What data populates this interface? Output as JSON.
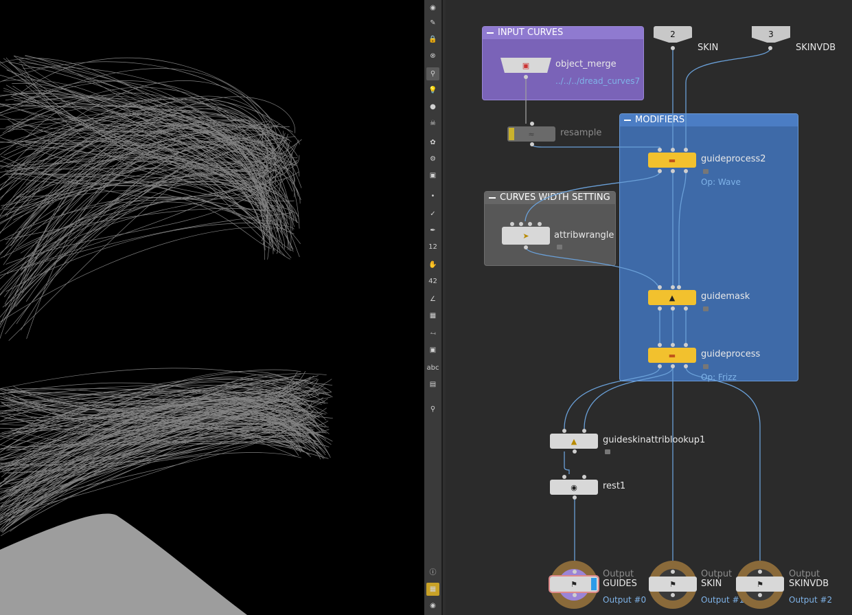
{
  "network": {
    "boxes": {
      "input_curves": "INPUT CURVES",
      "modifiers": "MODIFIERS",
      "curves_width": "CURVES WIDTH SETTING"
    },
    "subnet_inputs": [
      {
        "index": "2",
        "label": "SKIN"
      },
      {
        "index": "3",
        "label": "SKINVDB"
      }
    ],
    "nodes": {
      "object_merge": {
        "name": "object_merge",
        "sub": "../../../dread_curves7"
      },
      "resample": {
        "name": "resample"
      },
      "attribwrangle": {
        "name": "attribwrangle"
      },
      "guideprocess2": {
        "name": "guideprocess2",
        "sub": "Op: Wave"
      },
      "guidemask": {
        "name": "guidemask"
      },
      "guideprocess": {
        "name": "guideprocess",
        "sub": "Op: Frizz"
      },
      "guideskinattriblookup1": {
        "name": "guideskinattriblookup1"
      },
      "rest1": {
        "name": "rest1"
      }
    },
    "outputs": [
      {
        "type": "Output",
        "name": "GUIDES",
        "index": "Output #0"
      },
      {
        "type": "Output",
        "name": "SKIN",
        "index": "Output #1"
      },
      {
        "type": "Output",
        "name": "SKINVDB",
        "index": "Output #2"
      }
    ]
  },
  "toolbar": {
    "items": [
      "eye-toggle-icon",
      "pencil-eye-icon",
      "lock-icon",
      "close-circle-icon",
      "magnifier-icon",
      "light-bulb-icon",
      "light-bulb-small-icon",
      "skull-icon",
      "handles-icon",
      "camera-options-icon",
      "camera-icon",
      "point-icon",
      "brush-icon",
      "pen-icon",
      "number-12-icon",
      "paint-icon",
      "number-42-icon",
      "angle-icon",
      "snap-grid-icon",
      "branch-icon",
      "shading-icon",
      "text-abc-icon",
      "background-image-icon",
      "pin-icon",
      "info-icon",
      "grid-view-icon",
      "visibility-icon"
    ],
    "abc_label": "abc",
    "n12": "12",
    "n42": "42"
  },
  "colors": {
    "node_yellow": "#f2c12e",
    "node_gray": "#d4d4d4",
    "modifiers_box": "#3f6fb0",
    "input_box": "#7a63b8",
    "width_box": "#5a5a5a",
    "wire": "#6aa0d8",
    "output_ring": "#8a6a3a"
  }
}
